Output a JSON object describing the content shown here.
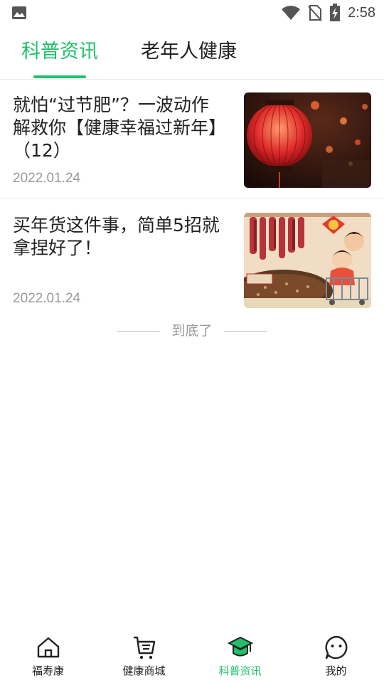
{
  "status_bar": {
    "time": "2:58"
  },
  "tabs": [
    {
      "label": "科普资讯",
      "active": true
    },
    {
      "label": "老年人健康",
      "active": false
    }
  ],
  "articles": [
    {
      "title": "就怕“过节肥”？一波动作解救你【健康幸福过新年】（12）",
      "date": "2022.01.24"
    },
    {
      "title": "买年货这件事，简单5招就拿捏好了！",
      "date": "2022.01.24"
    }
  ],
  "list_end": {
    "label": "到底了"
  },
  "bottom_nav": [
    {
      "label": "福寿康",
      "icon": "home-icon"
    },
    {
      "label": "健康商城",
      "icon": "cart-icon"
    },
    {
      "label": "科普资讯",
      "icon": "graduation-cap-icon",
      "active": true
    },
    {
      "label": "我的",
      "icon": "smiley-face-icon"
    }
  ],
  "colors": {
    "accent": "#1ec06a",
    "text": "#222222",
    "muted": "#999999"
  }
}
